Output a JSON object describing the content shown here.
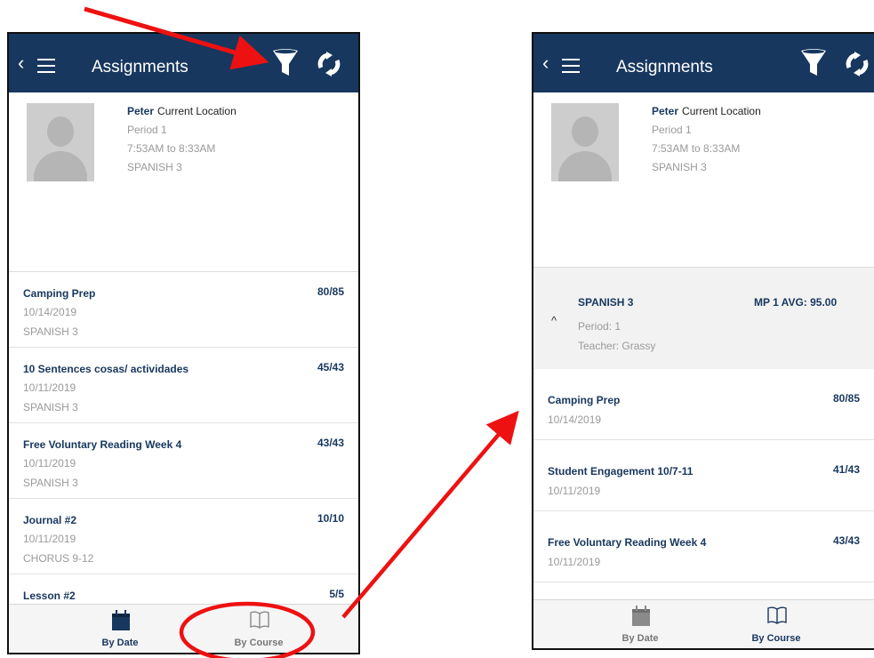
{
  "colors": {
    "header": "#17375e",
    "arrow": "#ee1111"
  },
  "left": {
    "title": "Assignments",
    "profile": {
      "name": "Peter",
      "location": "Current Location",
      "period": "Period 1",
      "time": "7:53AM to 8:33AM",
      "course": "SPANISH 3"
    },
    "assignments": [
      {
        "name": "Camping Prep",
        "date": "10/14/2019",
        "course": "SPANISH 3",
        "score": "80/85"
      },
      {
        "name": "10 Sentences cosas/ actividades",
        "date": "10/11/2019",
        "course": "SPANISH 3",
        "score": "45/43"
      },
      {
        "name": "Free Voluntary Reading Week 4",
        "date": "10/11/2019",
        "course": "SPANISH 3",
        "score": "43/43"
      },
      {
        "name": "Journal #2",
        "date": "10/11/2019",
        "course": "CHORUS 9-12",
        "score": "10/10"
      },
      {
        "name": "Lesson #2",
        "date": "",
        "course": "",
        "score": "5/5"
      }
    ],
    "tabs": {
      "by_date": "By Date",
      "by_course": "By Course",
      "active": "by_date"
    }
  },
  "right": {
    "title": "Assignments",
    "profile": {
      "name": "Peter",
      "location": "Current Location",
      "period": "Period 1",
      "time": "7:53AM to 8:33AM",
      "course": "SPANISH 3"
    },
    "course_header": {
      "name": "SPANISH 3",
      "avg": "MP 1 AVG: 95.00",
      "period": "Period: 1",
      "teacher": "Teacher: Grassy",
      "chevron": "^"
    },
    "assignments": [
      {
        "name": "Camping Prep",
        "date": "10/14/2019",
        "score": "80/85"
      },
      {
        "name": "Student Engagement 10/7-11",
        "date": "10/11/2019",
        "score": "41/43"
      },
      {
        "name": "Free Voluntary Reading Week 4",
        "date": "10/11/2019",
        "score": "43/43"
      }
    ],
    "tabs": {
      "by_date": "By Date",
      "by_course": "By Course",
      "active": "by_course"
    }
  },
  "icons": {
    "back": "‹",
    "menu": "hamburger-icon",
    "filter": "funnel-icon",
    "refresh": "refresh-icon",
    "calendar": "calendar-icon",
    "book": "book-icon"
  }
}
